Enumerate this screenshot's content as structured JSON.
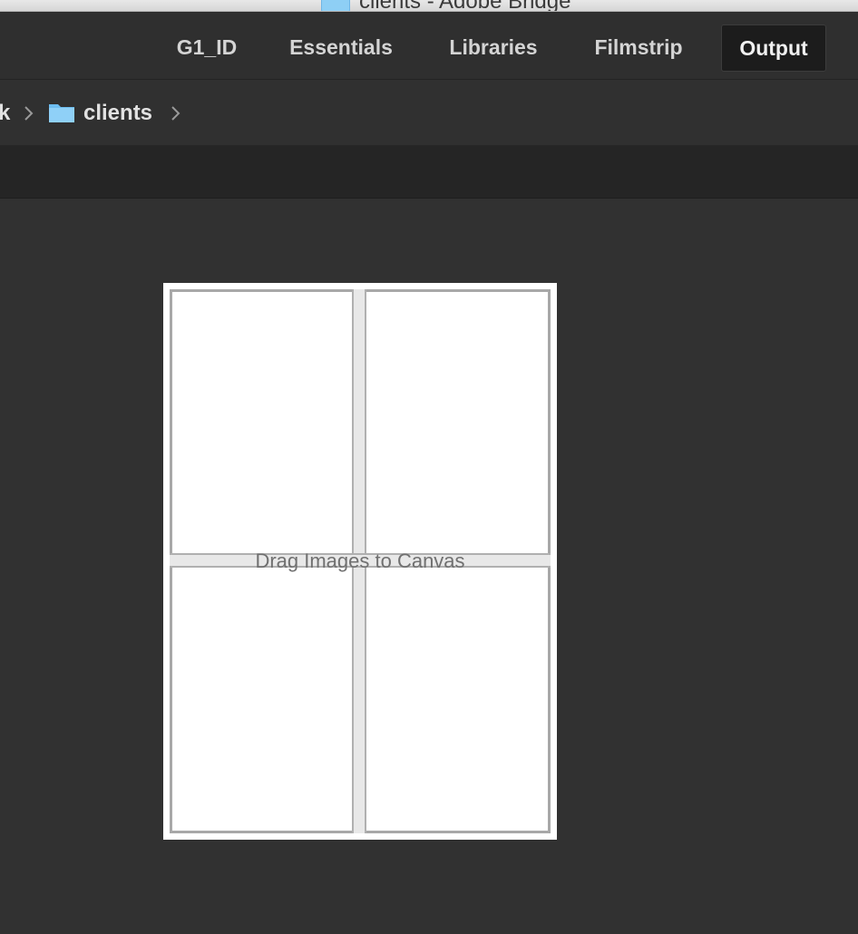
{
  "window": {
    "title": "clients - Adobe Bridge"
  },
  "workspaces": [
    {
      "label": "G1_ID",
      "active": false
    },
    {
      "label": "Essentials",
      "active": false
    },
    {
      "label": "Libraries",
      "active": false
    },
    {
      "label": "Filmstrip",
      "active": false
    },
    {
      "label": "Output",
      "active": true
    }
  ],
  "path_bar": {
    "previous_segment": "k",
    "current_folder": "clients",
    "folder_icon": "folder-icon",
    "separator_icon": "chevron-right-icon"
  },
  "canvas": {
    "hint": "Drag Images to Canvas",
    "layout": "2x2 grid"
  },
  "colors": {
    "background": "#313131",
    "folder_blue": "#7cc8f4",
    "active_tab_bg": "#1c1c1c"
  }
}
